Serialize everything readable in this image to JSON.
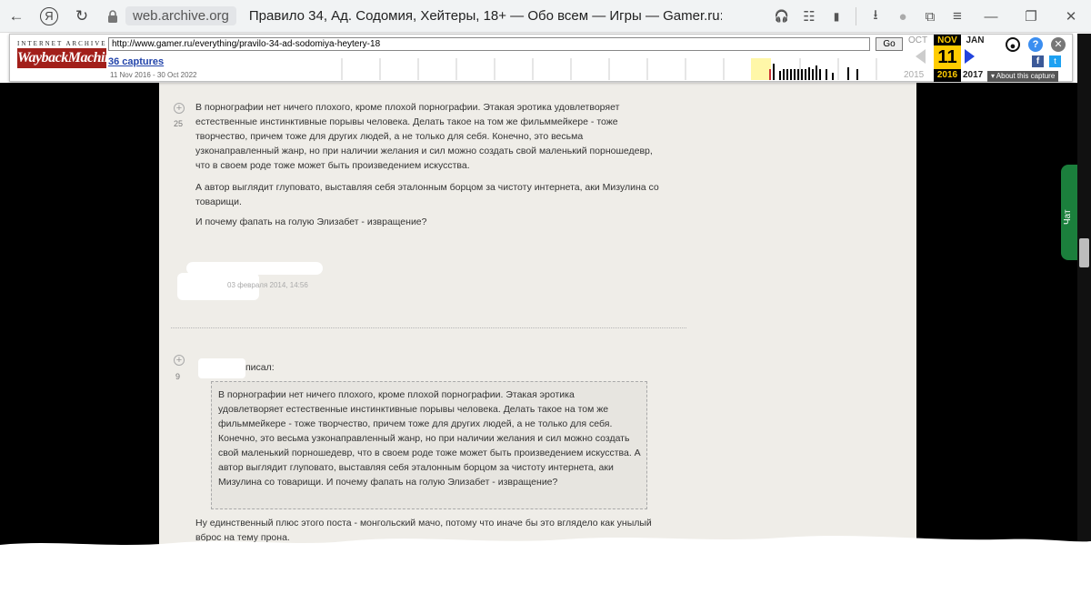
{
  "browser": {
    "nav": {
      "back": "←",
      "yandex": "Я",
      "reload": "↻"
    },
    "host": "web.archive.org",
    "tab_title": "Правило 34, Ад. Содомия, Хейтеры, 18+ — Обо всем — Игры — Gamer.ru: соц...",
    "right_icons": [
      "headphones-icon",
      "reader-icon",
      "bookmark-icon",
      "download-icon",
      "account-icon",
      "collections-icon",
      "menu-icon",
      "minimize-icon",
      "restore-icon",
      "close-icon"
    ],
    "glyphs": {
      "headphones": "🎧",
      "reader": "☷",
      "bookmark": "▮",
      "download": "⭳",
      "account": "●",
      "collections": "⧉",
      "menu": "≡",
      "minimize": "—",
      "restore": "❐",
      "close": "✕"
    }
  },
  "wayback": {
    "ia_label": "INTERNET ARCHIVE",
    "logo_text": "WaybackMachine",
    "url": "http://www.gamer.ru/everything/pravilo-34-ad-sodomiya-heytery-18",
    "go_label": "Go",
    "captures_label": "36 captures",
    "date_range": "11 Nov 2016 - 30 Oct 2022",
    "months": {
      "prev": "OCT",
      "current": "NOV",
      "next": "JAN"
    },
    "day": "11",
    "years": {
      "prev": "2015",
      "current": "2016",
      "next": "2017"
    },
    "about_label": "▾ About this capture",
    "icons": {
      "help": "?",
      "close": "✕",
      "facebook": "f",
      "twitter": "t",
      "user": "●"
    }
  },
  "chat": {
    "label": "Чат"
  },
  "comment1": {
    "vote": "25",
    "plus": "+",
    "paragraphs": [
      "В порнографии нет ничего плохого, кроме плохой порнографии. Этакая эротика удовлетворяет естественные инстинктивные порывы человека. Делать такое на том же фильммейкере - тоже творчество, причем тоже для других людей, а не только для себя. Конечно, это весьма узконаправленный жанр, но при наличии желания и сил можно создать свой маленький порношедевр, что в своем роде тоже может быть произведением искусства.",
      "А автор выглядит глуповато, выставляя себя эталонным борцом за чистоту интернета, аки Мизулина со товарищи.",
      "И почему фапать на голую Элизабет - извращение?"
    ],
    "date": "03 февраля 2014, 14:56"
  },
  "comment2": {
    "vote": "9",
    "plus": "+",
    "wrote": "писал:",
    "quote": "В порнографии нет ничего плохого, кроме плохой порнографии. Этакая эротика удовлетворяет естественные инстинктивные порывы человека. Делать такое на том же фильммейкере - тоже творчество, причем тоже для других людей, а не только для себя. Конечно, это весьма узконаправленный жанр, но при наличии желания и сил можно создать свой маленький порношедевр, что в своем роде тоже может быть произведением искусства. А автор выглядит глуповато, выставляя себя эталонным борцом за чистоту интернета, аки Мизулина со товарищи. И почему фапать на голую Элизабет - извращение?",
    "reply": "Ну единственный плюс этого поста - монгольский мачо, потому что иначе бы это вглядело как унылый вброс на тему прона."
  }
}
